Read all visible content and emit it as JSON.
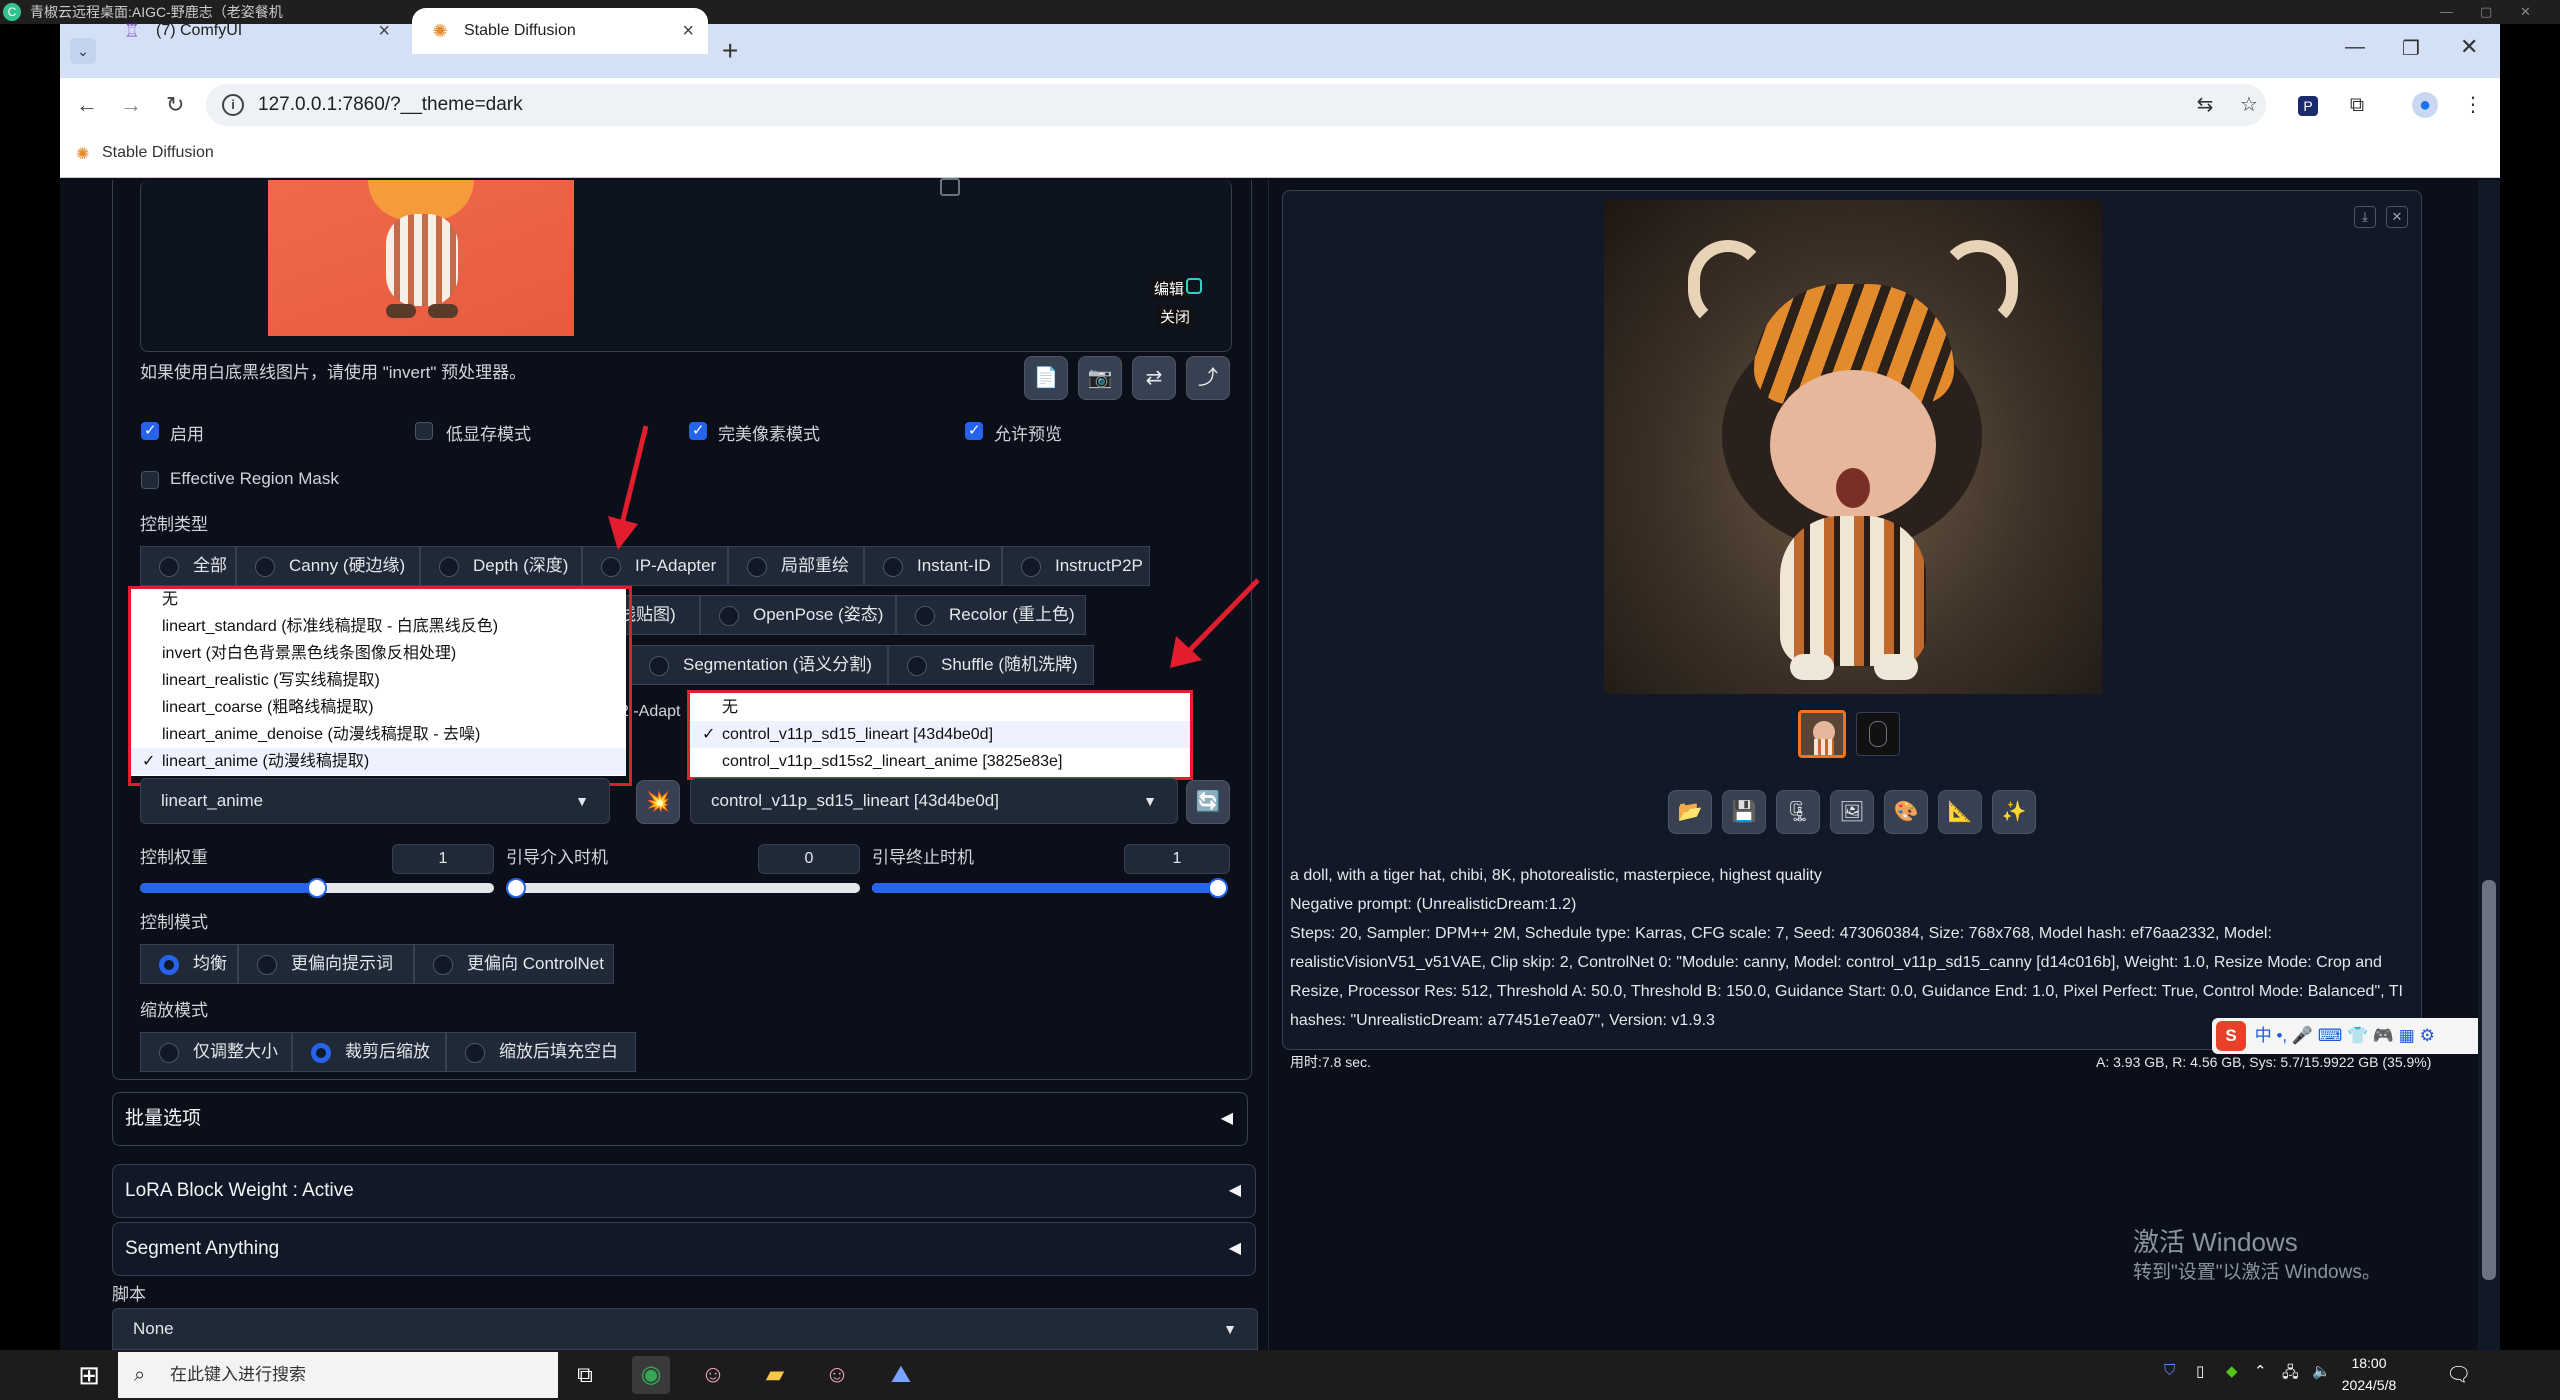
{
  "remote_desktop": {
    "title": "青椒云远程桌面:AIGC-野鹿志（老姿餐机"
  },
  "browser": {
    "tabs": [
      {
        "label": "(7) ComfyUI",
        "icon": "comfyui-icon"
      },
      {
        "label": "Stable Diffusion",
        "icon": "stable-diffusion-icon"
      }
    ],
    "url": "127.0.0.1:7860/?__theme=dark",
    "bookmark": "Stable Diffusion"
  },
  "controlnet": {
    "image_controls": {
      "edit": "编辑",
      "close": "关闭"
    },
    "invert_hint": "如果使用白底黑线图片，请使用 \"invert\" 预处理器。",
    "checkboxes": [
      {
        "label": "启用",
        "checked": true
      },
      {
        "label": "低显存模式",
        "checked": false
      },
      {
        "label": "完美像素模式",
        "checked": true
      },
      {
        "label": "允许预览",
        "checked": true
      }
    ],
    "effective_region_mask": {
      "label": "Effective Region Mask",
      "checked": false
    },
    "control_type_label": "控制类型",
    "control_types_row1": [
      "全部",
      "Canny (硬边缘)",
      "Depth (深度)",
      "IP-Adapter",
      "局部重绘",
      "Instant-ID",
      "InstructP2P"
    ],
    "control_types_row2": [
      "线贴图)",
      "OpenPose (姿态)",
      "Recolor (重上色)"
    ],
    "control_types_row3": [
      "Segmentation (语义分割)",
      "Shuffle (随机洗牌)"
    ],
    "control_types_row4": [
      "2I-Adapt"
    ],
    "preprocessor_menu": [
      {
        "label": "无",
        "checked": false
      },
      {
        "label": "lineart_standard (标准线稿提取 - 白底黑线反色)",
        "checked": false
      },
      {
        "label": "invert (对白色背景黑色线条图像反相处理)",
        "checked": false
      },
      {
        "label": "lineart_realistic (写实线稿提取)",
        "checked": false
      },
      {
        "label": "lineart_coarse (粗略线稿提取)",
        "checked": false
      },
      {
        "label": "lineart_anime_denoise (动漫线稿提取 - 去噪)",
        "checked": false
      },
      {
        "label": "lineart_anime (动漫线稿提取)",
        "checked": true
      }
    ],
    "model_menu": [
      {
        "label": "无",
        "checked": false
      },
      {
        "label": "control_v11p_sd15_lineart [43d4be0d]",
        "checked": true
      },
      {
        "label": "control_v11p_sd15s2_lineart_anime [3825e83e]",
        "checked": false
      }
    ],
    "preprocessor_value": "lineart_anime",
    "model_value": "control_v11p_sd15_lineart [43d4be0d]",
    "control_weight": {
      "label": "控制权重",
      "value": "1",
      "fraction": 0.5
    },
    "start_step": {
      "label": "引导介入时机",
      "value": "0",
      "fraction": 0.0
    },
    "end_step": {
      "label": "引导终止时机",
      "value": "1",
      "fraction": 1.0
    },
    "control_mode_label": "控制模式",
    "control_modes": [
      "均衡",
      "更偏向提示词",
      "更偏向 ControlNet"
    ],
    "resize_mode_label": "缩放模式",
    "resize_modes": [
      "仅调整大小",
      "裁剪后缩放",
      "缩放后填充空白"
    ],
    "batch_label": "批量选项"
  },
  "accordions": [
    "LoRA Block Weight : Active",
    "Segment Anything"
  ],
  "script": {
    "label": "脚本",
    "value": "None"
  },
  "output": {
    "prompt": "a doll, with a tiger hat, chibi, 8K, photorealistic, masterpiece, highest quality",
    "negative": "Negative prompt: (UnrealisticDream:1.2)",
    "params": [
      "Steps: 20, Sampler: DPM++ 2M, Schedule type: Karras, CFG scale: 7, Seed: 473060384, Size: 768x768, Model hash: ef76aa2332, Model:",
      "realisticVisionV51_v51VAE, Clip skip: 2, ControlNet 0: \"Module: canny, Model: control_v11p_sd15_canny [d14c016b], Weight: 1.0, Resize Mode: Crop and",
      "Resize, Processor Res: 512, Threshold A: 50.0, Threshold B: 150.0, Guidance Start: 0.0, Guidance End: 1.0, Pixel Perfect: True, Control Mode: Balanced\", TI",
      "hashes: \"UnrealisticDream: a77451e7ea07\", Version: v1.9.3"
    ],
    "time": "用时:7.8 sec.",
    "vram": "A: 3.93 GB, R: 4.56 GB, Sys: 5.7/15.9922 GB (35.9%)"
  },
  "windows": {
    "activate_title": "激活 Windows",
    "activate_sub": "转到\"设置\"以激活 Windows。",
    "search_placeholder": "在此键入进行搜索",
    "time": "18:00",
    "date": "2024/5/8",
    "ime": "中"
  },
  "colors": {
    "accent": "#2563eb",
    "annotation": "#e11d2e",
    "panel_bg": "#0b0f19"
  }
}
